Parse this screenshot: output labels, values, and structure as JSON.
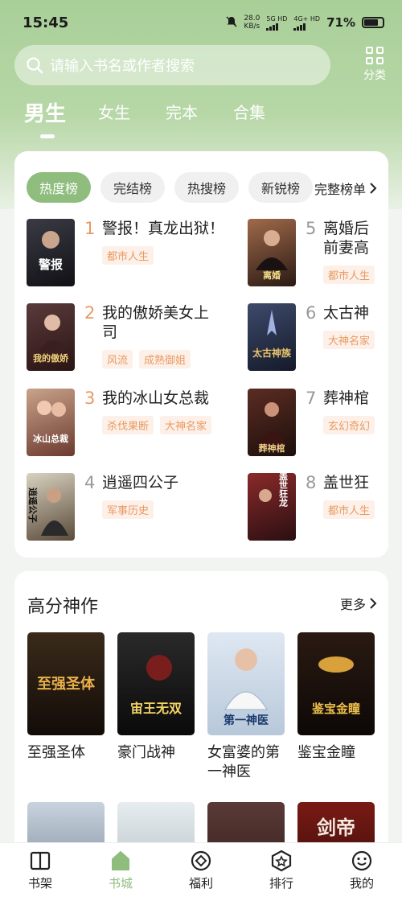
{
  "status_bar": {
    "time": "15:45",
    "net_speed_value": "28.0",
    "net_speed_unit": "KB/s",
    "sim1": "5G HD",
    "sim2": "4G+ HD",
    "battery": "71%"
  },
  "search": {
    "placeholder": "请输入书名或作者搜索"
  },
  "category_label": "分类",
  "gender_tabs": [
    "男生",
    "女生",
    "完本",
    "合集"
  ],
  "rank_chips": [
    "热度榜",
    "完结榜",
    "热搜榜",
    "新锐榜"
  ],
  "full_list_label": "完整榜单",
  "rank_items": [
    {
      "num": "1",
      "title": "警报！真龙出狱！",
      "tags": [
        "都市人生"
      ],
      "cover_text": "警报"
    },
    {
      "num": "2",
      "title": "我的傲娇美女上",
      "title2": "司",
      "tags": [
        "风流",
        "成熟御姐"
      ],
      "cover_text": "我的傲娇"
    },
    {
      "num": "3",
      "title": "我的冰山女总裁",
      "tags": [
        "杀伐果断",
        "大神名家"
      ],
      "cover_text": "冰山总裁"
    },
    {
      "num": "4",
      "title": "逍遥四公子",
      "tags": [
        "军事历史"
      ],
      "cover_text": "逍遥公子"
    },
    {
      "num": "5",
      "title": "离婚后",
      "title2": "前妻高",
      "tags": [
        "都市人生"
      ],
      "cover_text": "离婚"
    },
    {
      "num": "6",
      "title": "太古神",
      "tags": [
        "大神名家"
      ],
      "cover_text": "太古神族"
    },
    {
      "num": "7",
      "title": "葬神棺",
      "tags": [
        "玄幻奇幻"
      ],
      "cover_text": "葬神棺"
    },
    {
      "num": "8",
      "title": "盖世狂",
      "tags": [
        "都市人生"
      ],
      "cover_text": "盖世狂龙"
    }
  ],
  "high_score": {
    "title": "高分神作",
    "more_label": "更多",
    "books": [
      {
        "title": "至强圣体",
        "cover_text": "至强圣体"
      },
      {
        "title": "豪门战神",
        "cover_text": "宙王无双"
      },
      {
        "title": "女富婆的第一神医",
        "cover_text": "第一神医"
      },
      {
        "title": "鉴宝金瞳",
        "cover_text": "鉴宝金瞳"
      },
      {
        "title": "",
        "cover_text": ""
      },
      {
        "title": "",
        "cover_text": ""
      },
      {
        "title": "",
        "cover_text": ""
      },
      {
        "title": "",
        "cover_text": "剑帝"
      }
    ]
  },
  "tabbar": [
    "书架",
    "书城",
    "福利",
    "排行",
    "我的"
  ],
  "colors": {
    "accent": "#8fbd7d",
    "tag_text": "#e99a63",
    "tag_bg": "#fdf0e8",
    "hero": "#a9cf98"
  }
}
